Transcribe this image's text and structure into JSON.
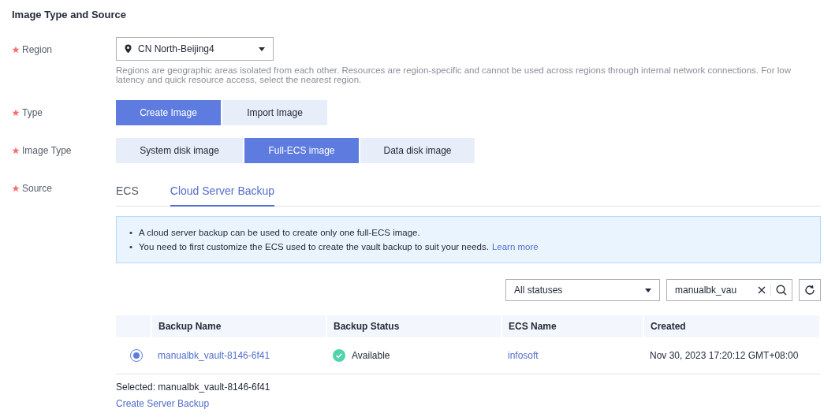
{
  "section_title": "Image Type and Source",
  "region": {
    "label": "Region",
    "required": true,
    "value": "CN North-Beijing4",
    "hint": "Regions are geographic areas isolated from each other. Resources are region-specific and cannot be used across regions through internal network connections. For low latency and quick resource access, select the nearest region."
  },
  "type": {
    "label": "Type",
    "required": true,
    "options": [
      {
        "label": "Create Image",
        "selected": true
      },
      {
        "label": "Import Image",
        "selected": false
      }
    ]
  },
  "image_type": {
    "label": "Image Type",
    "required": true,
    "options": [
      {
        "label": "System disk image",
        "selected": false
      },
      {
        "label": "Full-ECS image",
        "selected": true
      },
      {
        "label": "Data disk image",
        "selected": false
      }
    ]
  },
  "source": {
    "label": "Source",
    "required": true,
    "tabs": [
      {
        "label": "ECS",
        "selected": false
      },
      {
        "label": "Cloud Server Backup",
        "selected": true
      }
    ]
  },
  "notice": [
    {
      "bullet": "•",
      "text": "A cloud server backup can be used to create only one full-ECS image."
    },
    {
      "bullet": "•",
      "text": "You need to first customize the ECS used to create the vault backup to suit your needs.",
      "link": "Learn more"
    }
  ],
  "status_filter": {
    "value": "All statuses"
  },
  "search": {
    "value": "manualbk_vau"
  },
  "table": {
    "columns": [
      "Backup Name",
      "Backup Status",
      "ECS Name",
      "Created"
    ],
    "rows": [
      {
        "selected": true,
        "backup_name": "manualbk_vault-8146-6f41",
        "status": "Available",
        "ecs_name": "infosoft",
        "created": "Nov 30, 2023 17:20:12 GMT+08:00"
      }
    ]
  },
  "selected_text": "Selected: manualbk_vault-8146-6f41",
  "create_link": "Create Server Backup"
}
